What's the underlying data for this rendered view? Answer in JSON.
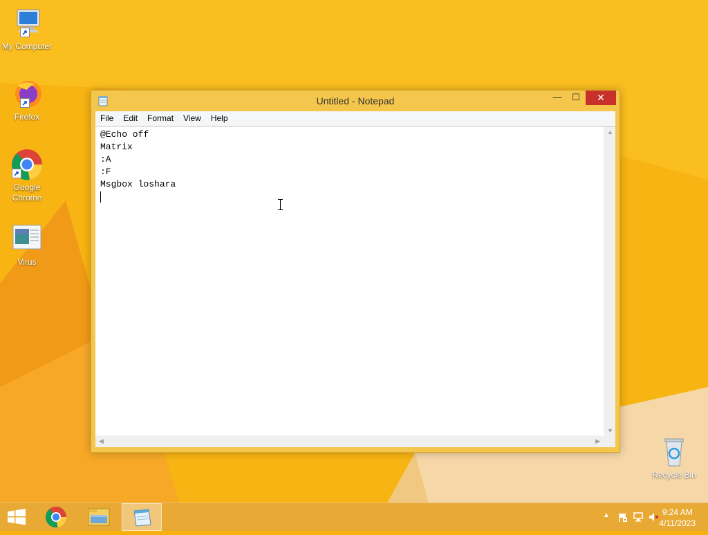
{
  "desktop": {
    "icons": [
      {
        "label": "My Computer",
        "icon": "computer-icon"
      },
      {
        "label": "Firefox",
        "icon": "firefox-icon"
      },
      {
        "label": "Google Chrome",
        "icon": "chrome-icon"
      },
      {
        "label": "Virus",
        "icon": "document-icon"
      },
      {
        "label": "Recycle Bin",
        "icon": "recycle-bin-icon"
      }
    ]
  },
  "window": {
    "title": "Untitled - Notepad",
    "buttons": {
      "minimize": "—",
      "maximize": "☐",
      "close": "✕"
    },
    "menu": [
      "File",
      "Edit",
      "Format",
      "View",
      "Help"
    ],
    "content_lines": [
      "@Echo off",
      "Matrix",
      ":A",
      ":F",
      "Msgbox loshara"
    ]
  },
  "taskbar": {
    "apps": [
      "start-icon",
      "chrome-icon",
      "file-explorer-icon",
      "notepad-icon"
    ],
    "time": "9:24 AM",
    "date": "4/11/2023"
  },
  "colors": {
    "desktop": "#f7b010",
    "window_frame": "#f4c64b",
    "close": "#c7312a"
  }
}
